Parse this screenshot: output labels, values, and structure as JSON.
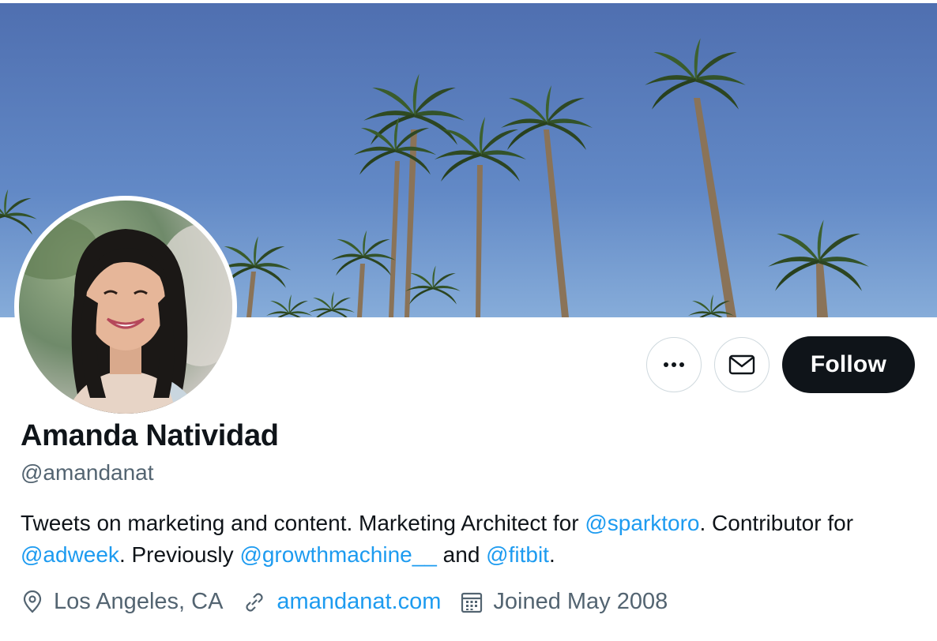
{
  "profile": {
    "name": "Amanda Natividad",
    "handle": "@amandanat"
  },
  "actions": {
    "more_icon": "more-horizontal-icon",
    "message_icon": "mail-icon",
    "follow_label": "Follow"
  },
  "bio": {
    "part1": "Tweets on marketing and content. Marketing Architect for ",
    "mention1": "@sparktoro",
    "part2": ". Contributor for ",
    "mention2": "@adweek",
    "part3": ". Previously ",
    "mention3": "@growthmachine__",
    "part4": " and ",
    "mention4": "@fitbit",
    "part5": "."
  },
  "meta": {
    "location": "Los Angeles, CA",
    "website": "amandanat.com",
    "joined": "Joined May 2008"
  },
  "colors": {
    "accent": "#1d9bf0",
    "follow_bg": "#0f1419",
    "secondary_text": "#536471"
  }
}
